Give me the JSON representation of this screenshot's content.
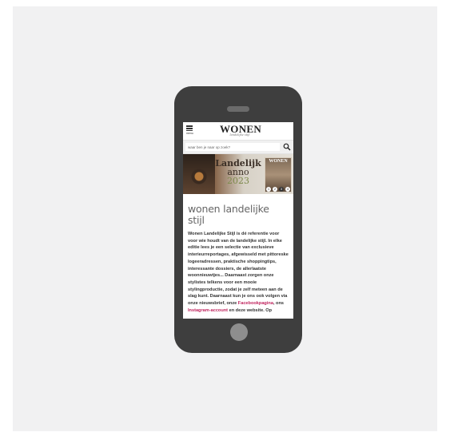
{
  "header": {
    "menu_label": "menu",
    "logo_main": "WONEN",
    "logo_sub": "landelijke stijl"
  },
  "search": {
    "placeholder": "waar ben je naar op zoek?"
  },
  "banner": {
    "line1": "Landelijk",
    "line2": "anno",
    "line3": "2023",
    "magazine_title": "WONEN",
    "slides": [
      "1",
      "2",
      "3",
      "4"
    ],
    "active_slide": 3
  },
  "main": {
    "title": "wonen landelijke stijl",
    "paragraph_part1": "Wonen Landelijke Stijl is dé referentie voor voor wie houdt van de landelijke stijl. In elke editie lees je een selectie van exclusieve interieurreportages, afgewisseld met pittoreske logeeradressen, praktische shoppingtips, interessante dossiers, de allerlaatste woonnieuwtjes... Daarnaast zorgen onze stylistes telkens voor een mooie stylingproductie, zodat je zelf meteen aan de slag kunt. Daarnaast kun je ons ook volgen via onze nieuwsbrief, onze ",
    "facebook_link": "Facebookpagina",
    "paragraph_part2": ", ons ",
    "instagram_link": "Instagram-account",
    "paragraph_part3": " en deze website. Op"
  },
  "colors": {
    "link": "#c0245e",
    "phone_body": "#3e3e3e",
    "backdrop": "#f1f1f2"
  },
  "icons": [
    "hamburger-menu-icon",
    "search-icon"
  ]
}
